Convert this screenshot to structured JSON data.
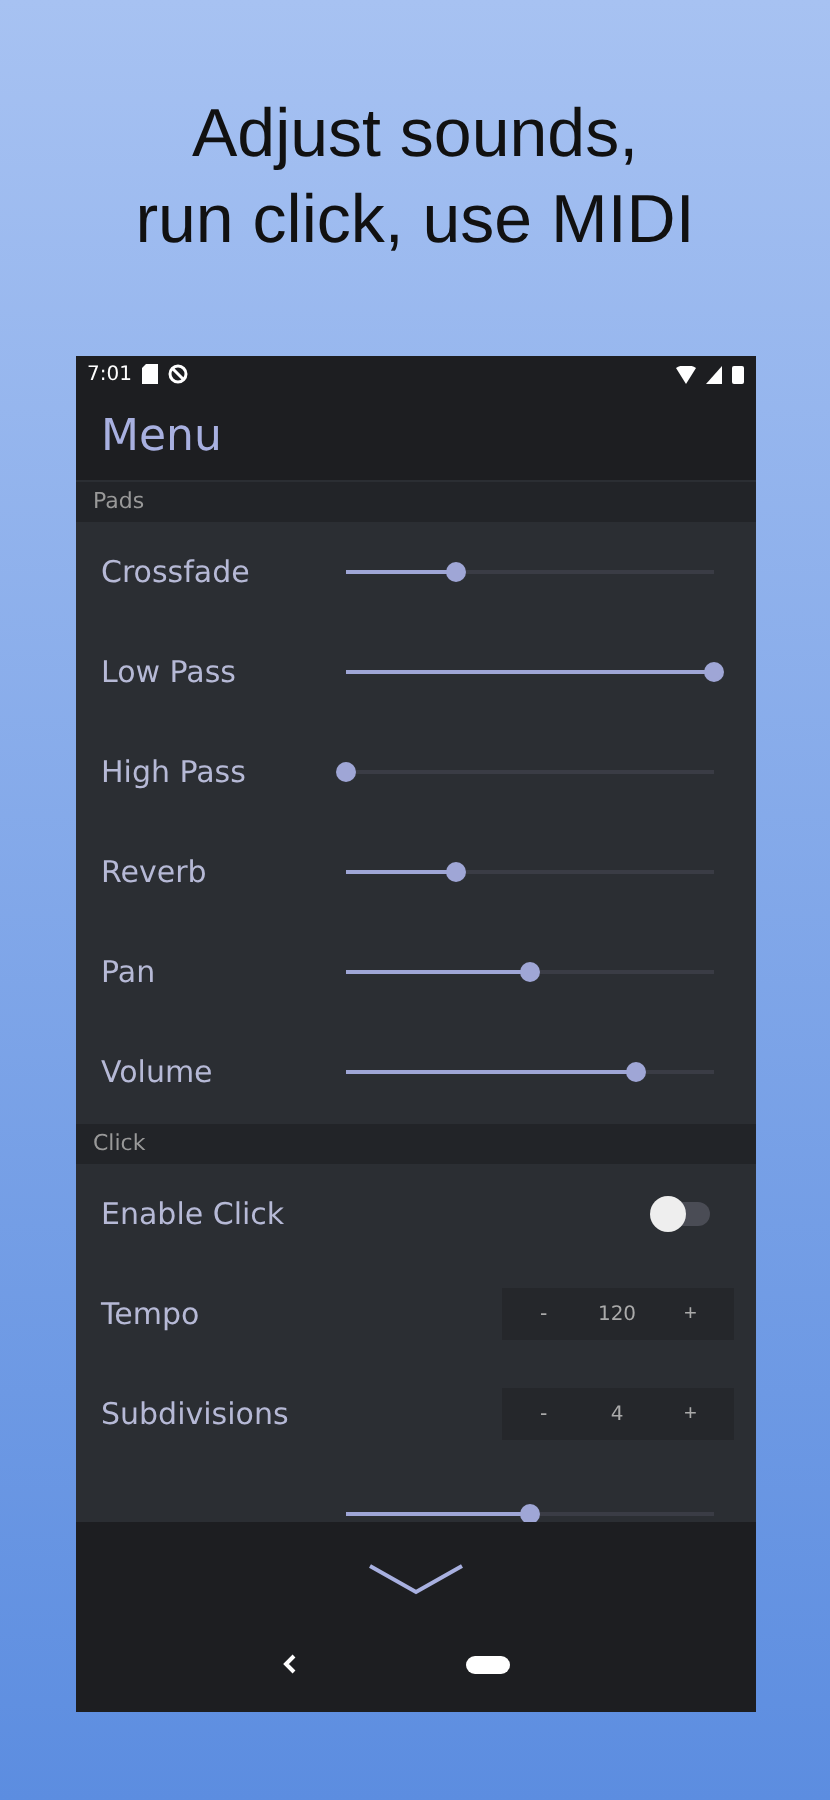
{
  "headline": [
    "Adjust sounds,",
    "run click, use MIDI"
  ],
  "status_bar": {
    "time": "7:01"
  },
  "app_bar": {
    "title": "Menu"
  },
  "sections": [
    {
      "title": "Pads",
      "rows": [
        {
          "kind": "slider",
          "label": "Crossfade",
          "level": 0.3
        },
        {
          "kind": "slider",
          "label": "Low Pass",
          "level": 1.0
        },
        {
          "kind": "slider",
          "label": "High Pass",
          "level": 0.0
        },
        {
          "kind": "slider",
          "label": "Reverb",
          "level": 0.3
        },
        {
          "kind": "slider",
          "label": "Pan",
          "level": 0.5
        },
        {
          "kind": "slider",
          "label": "Volume",
          "level": 0.79
        }
      ]
    },
    {
      "title": "Click",
      "rows": [
        {
          "kind": "switch",
          "label": "Enable Click",
          "on": false
        },
        {
          "kind": "stepper",
          "label": "Tempo",
          "minus": "-",
          "value": "120",
          "plus": "+"
        },
        {
          "kind": "stepper",
          "label": "Subdivisions",
          "minus": "-",
          "value": "4",
          "plus": "+"
        },
        {
          "kind": "slider",
          "level": 0.5
        }
      ]
    }
  ]
}
